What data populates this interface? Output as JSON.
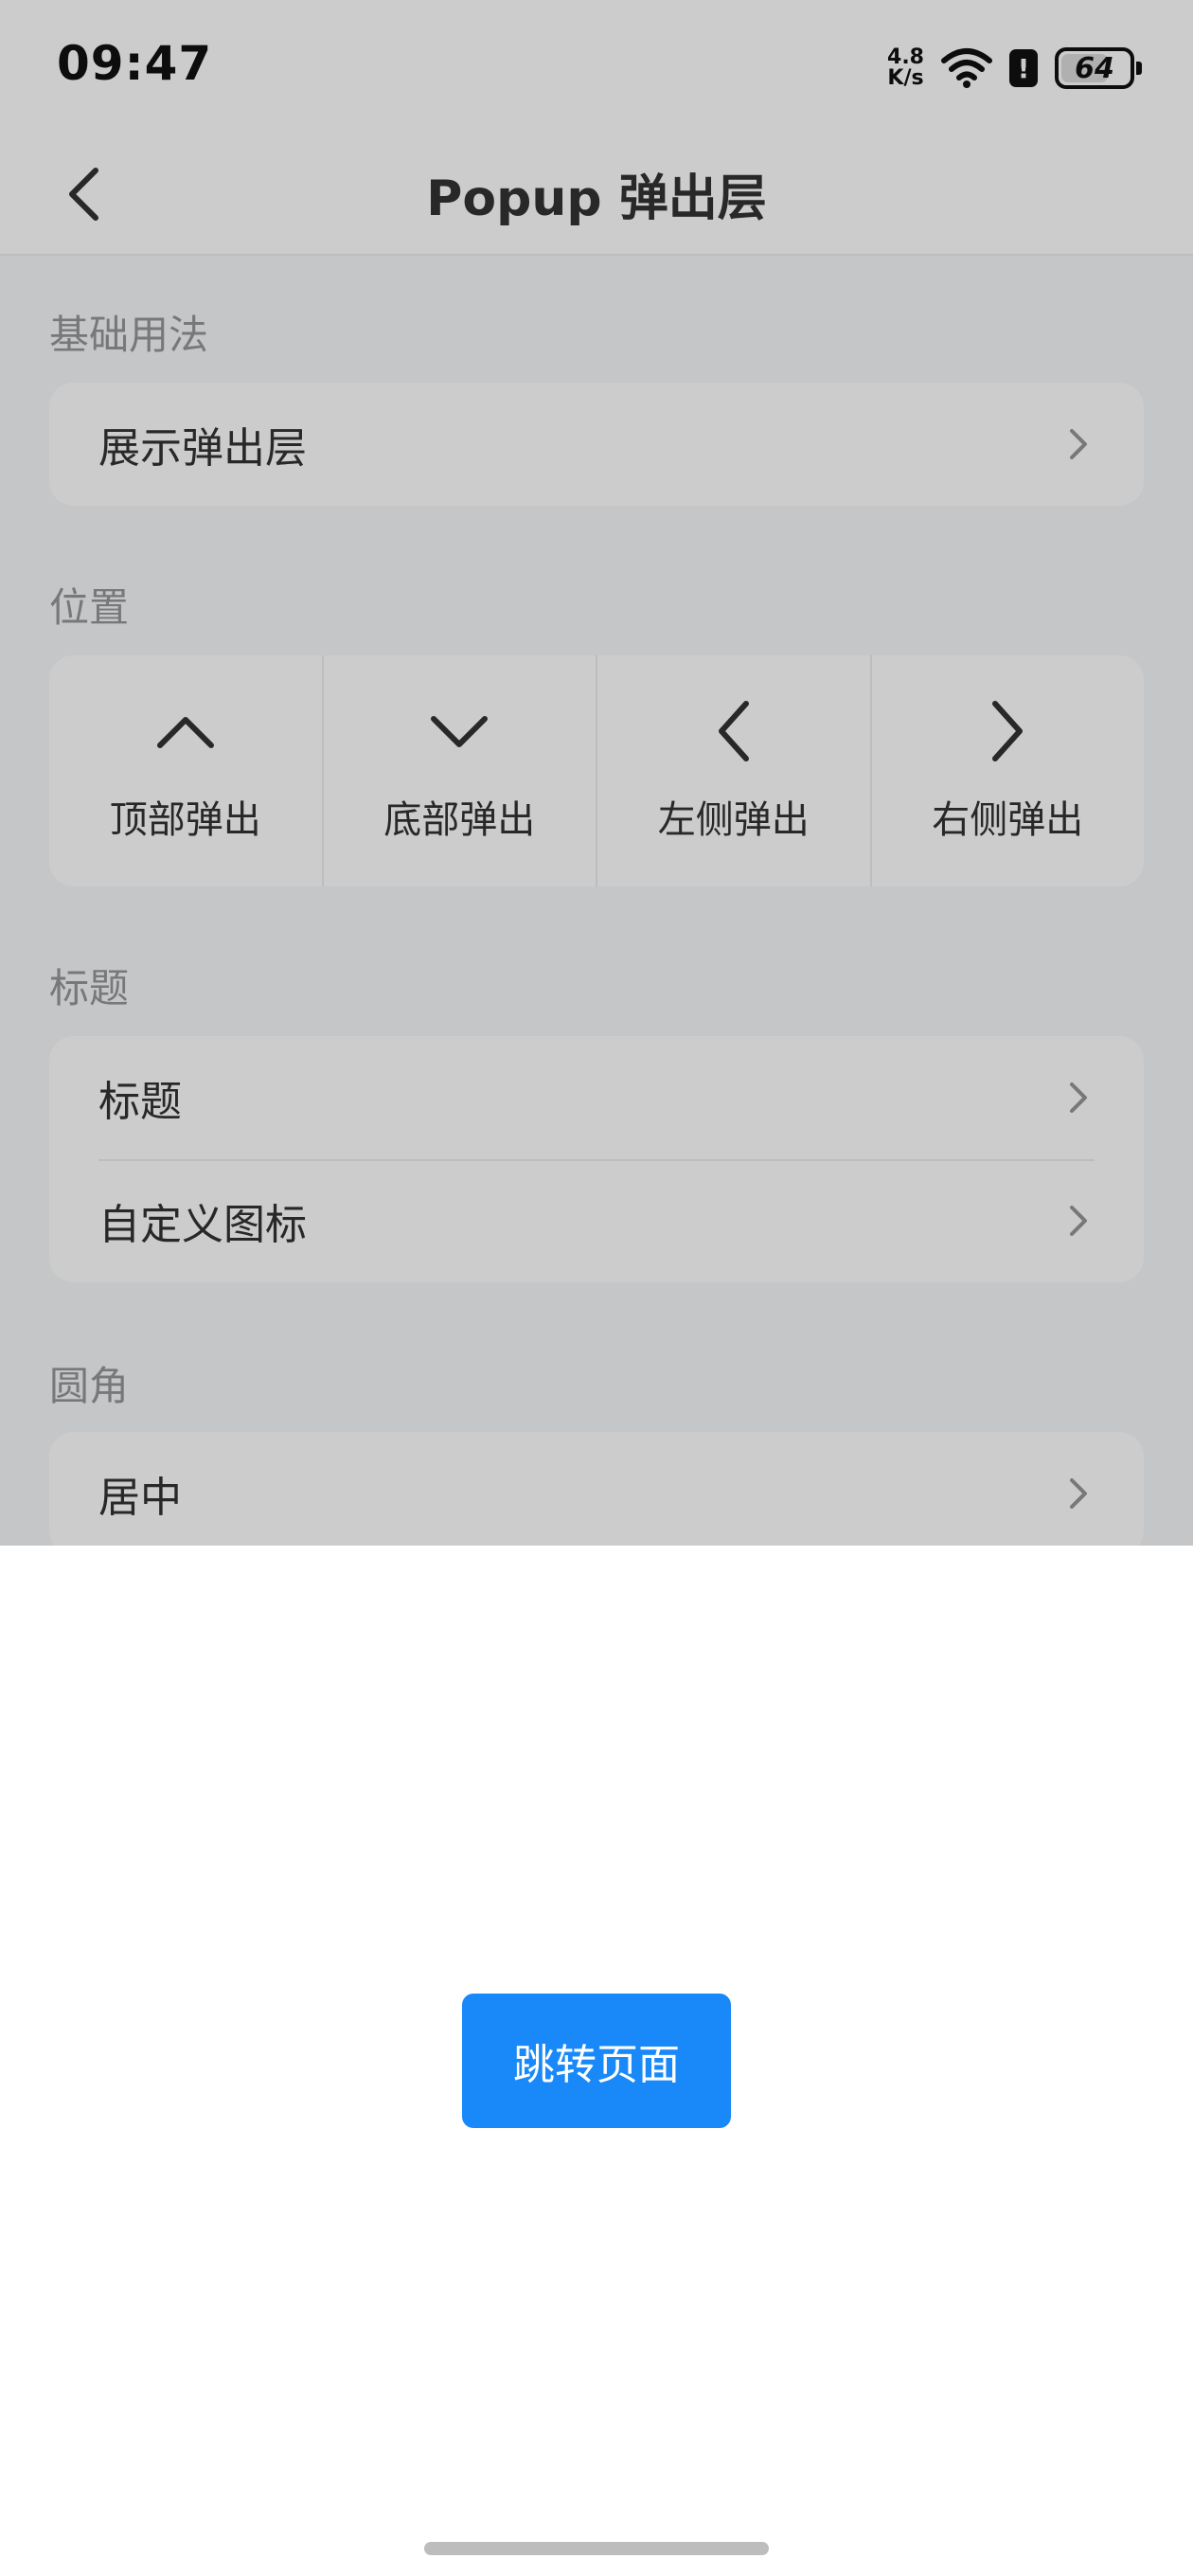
{
  "status_bar": {
    "time": "09:47",
    "net_speed_value": "4.8",
    "net_speed_unit": "K/s",
    "alert_badge": "!",
    "battery_level": "64",
    "icons": [
      "wifi-icon",
      "alert-icon",
      "battery-icon"
    ]
  },
  "navbar": {
    "title": "Popup 弹出层",
    "back_icon": "chevron-left-icon"
  },
  "sections": {
    "basic": {
      "title": "基础用法",
      "items": [
        {
          "label": "展示弹出层"
        }
      ]
    },
    "position": {
      "title": "位置",
      "items": [
        {
          "label": "顶部弹出",
          "icon": "chevron-up-icon"
        },
        {
          "label": "底部弹出",
          "icon": "chevron-down-icon"
        },
        {
          "label": "左侧弹出",
          "icon": "chevron-left-icon"
        },
        {
          "label": "右侧弹出",
          "icon": "chevron-right-icon"
        }
      ]
    },
    "title_section": {
      "title": "标题",
      "items": [
        {
          "label": "标题"
        },
        {
          "label": "自定义图标"
        }
      ]
    },
    "round": {
      "title": "圆角",
      "items": [
        {
          "label": "居中"
        }
      ]
    }
  },
  "popup": {
    "button_label": "跳转页面",
    "button_color": "#1989fa"
  },
  "colors": {
    "text_primary": "#323233",
    "text_secondary": "#969799",
    "arrow": "#969799",
    "background": "#f7f8fa",
    "overlay": "rgba(0,0,0,0.2)"
  }
}
